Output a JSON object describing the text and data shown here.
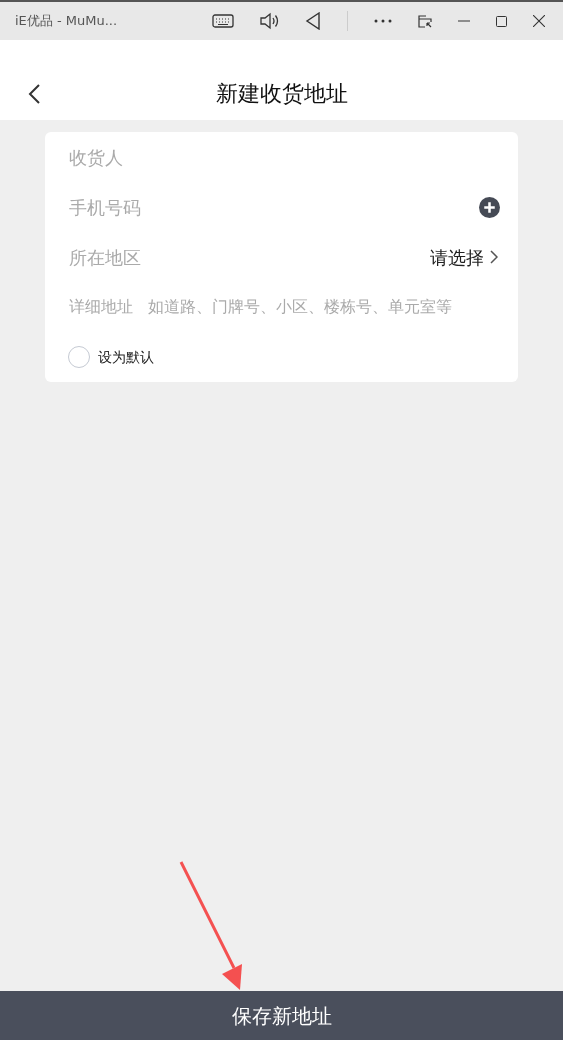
{
  "window": {
    "title": "iE优品 - MuMu..."
  },
  "header": {
    "title": "新建收货地址"
  },
  "form": {
    "fields": [
      {
        "kind": "text",
        "placeholder": "收货人"
      },
      {
        "kind": "phone",
        "placeholder": "手机号码"
      },
      {
        "kind": "select",
        "label": "所在地区",
        "value": "请选择"
      },
      {
        "kind": "detail",
        "label": "详细地址",
        "placeholder": "如道路、门牌号、小区、楼栋号、单元室等"
      }
    ],
    "default": {
      "label": "设为默认",
      "checked": false
    }
  },
  "save_button": {
    "label": "保存新地址"
  }
}
